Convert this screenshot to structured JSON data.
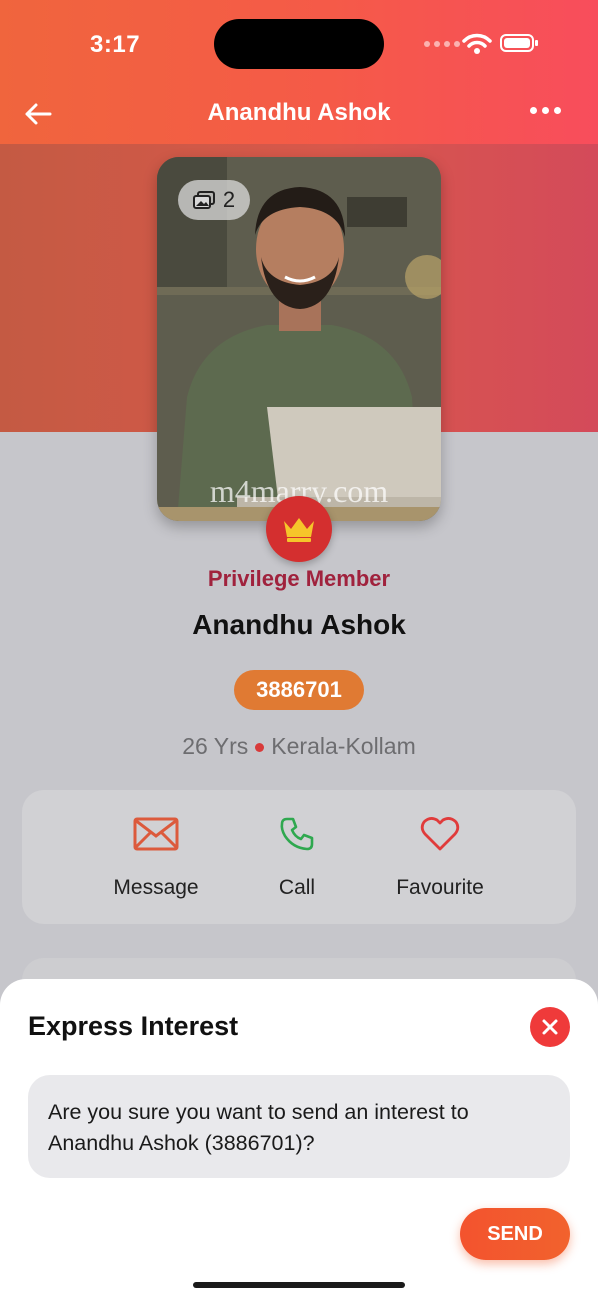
{
  "status_bar": {
    "time": "3:17"
  },
  "nav": {
    "title": "Anandhu Ashok",
    "back_icon": "arrow-left-icon",
    "more_icon": "more-horizontal-icon"
  },
  "profile": {
    "photo_count": "2",
    "watermark": "m4marry.com",
    "membership": "Privilege Member",
    "name": "Anandhu Ashok",
    "id": "3886701",
    "age": "26 Yrs",
    "location": "Kerala-Kollam"
  },
  "actions": [
    {
      "label": "Message",
      "icon": "mail-icon"
    },
    {
      "label": "Call",
      "icon": "phone-icon"
    },
    {
      "label": "Favourite",
      "icon": "heart-icon"
    }
  ],
  "sheet": {
    "title": "Express Interest",
    "message": "Are you sure you want to send an interest to Anandhu Ashok (3886701)?",
    "send_label": "SEND"
  },
  "colors": {
    "accent": "#f2552f",
    "member": "#a0223d",
    "id_badge": "#e07a33",
    "close": "#ef3a3a"
  }
}
